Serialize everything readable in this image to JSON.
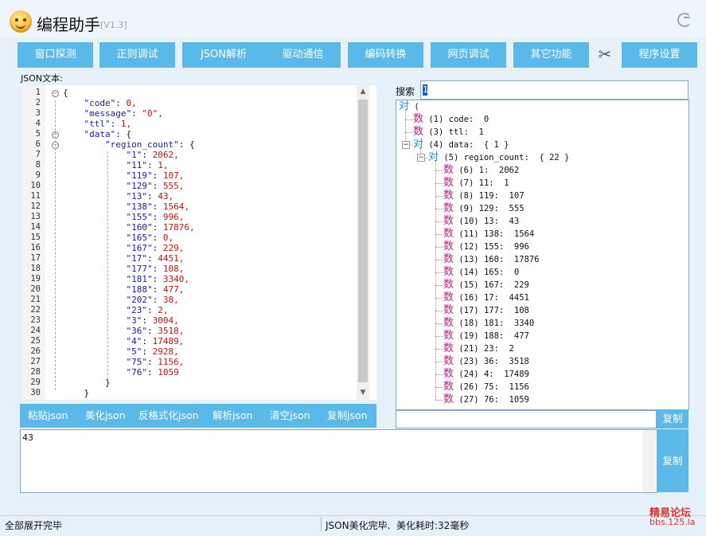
{
  "window": {
    "title": "编程助手",
    "version": "[V1.3]"
  },
  "menu": [
    "窗口探测",
    "正则调试",
    "JSON解析",
    "驱动通信",
    "编码转换",
    "网页调试",
    "其它功能",
    "程序设置"
  ],
  "editor": {
    "label": "JSON文本:",
    "line_numbers": [
      "1",
      "2",
      "3",
      "4",
      "5",
      "6",
      "7",
      "8",
      "9",
      "10",
      "11",
      "12",
      "13",
      "14",
      "15",
      "16",
      "17",
      "18",
      "19",
      "20",
      "21",
      "22",
      "23",
      "24",
      "25",
      "26",
      "27",
      "28",
      "29",
      "30"
    ],
    "lines": [
      "{",
      "    \"code\": 0,",
      "    \"message\": \"0\",",
      "    \"ttl\": 1,",
      "    \"data\": {",
      "        \"region_count\": {",
      "            \"1\": 2062,",
      "            \"11\": 1,",
      "            \"119\": 107,",
      "            \"129\": 555,",
      "            \"13\": 43,",
      "            \"138\": 1564,",
      "            \"155\": 996,",
      "            \"160\": 17876,",
      "            \"165\": 0,",
      "            \"167\": 229,",
      "            \"17\": 4451,",
      "            \"177\": 108,",
      "            \"181\": 3340,",
      "            \"188\": 477,",
      "            \"202\": 38,",
      "            \"23\": 2,",
      "            \"3\": 3004,",
      "            \"36\": 3518,",
      "            \"4\": 17489,",
      "            \"5\": 2928,",
      "            \"75\": 1156,",
      "            \"76\": 1059",
      "        }",
      "    }"
    ]
  },
  "json_buttons": [
    "粘贴json",
    "美化json",
    "反格式化json",
    "解析json",
    "清空json",
    "复制json"
  ],
  "search": {
    "label": "搜索",
    "value": "1"
  },
  "tree": {
    "root": "对 (",
    "nodes": [
      {
        "glyph": "数",
        "text": "(1) code:  0"
      },
      {
        "glyph": "数",
        "text": "(3) ttl:  1"
      },
      {
        "glyph": "对",
        "text": "(4) data:  { 1 }"
      },
      {
        "glyph": "对",
        "text": "(5) region_count:  { 22 }"
      },
      {
        "glyph": "数",
        "text": "(6) 1:  2062"
      },
      {
        "glyph": "数",
        "text": "(7) 11:  1"
      },
      {
        "glyph": "数",
        "text": "(8) 119:  107"
      },
      {
        "glyph": "数",
        "text": "(9) 129:  555"
      },
      {
        "glyph": "数",
        "text": "(10) 13:  43"
      },
      {
        "glyph": "数",
        "text": "(11) 138:  1564"
      },
      {
        "glyph": "数",
        "text": "(12) 155:  996"
      },
      {
        "glyph": "数",
        "text": "(13) 160:  17876"
      },
      {
        "glyph": "数",
        "text": "(14) 165:  0"
      },
      {
        "glyph": "数",
        "text": "(15) 167:  229"
      },
      {
        "glyph": "数",
        "text": "(16) 17:  4451"
      },
      {
        "glyph": "数",
        "text": "(17) 177:  108"
      },
      {
        "glyph": "数",
        "text": "(18) 181:  3340"
      },
      {
        "glyph": "数",
        "text": "(19) 188:  477"
      },
      {
        "glyph": "数",
        "text": "(21) 23:  2"
      },
      {
        "glyph": "数",
        "text": "(23) 36:  3518"
      },
      {
        "glyph": "数",
        "text": "(24) 4:  17489"
      },
      {
        "glyph": "数",
        "text": "(26) 75:  1156"
      },
      {
        "glyph": "数",
        "text": "(27) 76:  1059"
      }
    ]
  },
  "copy_label": "复制",
  "output_text": "43",
  "status": {
    "left": "全部展开完毕",
    "middle": "JSON美化完毕.",
    "right": "美化耗时:32毫秒"
  },
  "watermark": {
    "line1": "精易论坛",
    "line2": "bbs.125.la"
  },
  "colors": {
    "accent": "#5ab9e8",
    "key": "#1a1aa6",
    "value": "#c81010",
    "tree_num": "#c0208a",
    "tree_obj": "#1a8fd0"
  }
}
